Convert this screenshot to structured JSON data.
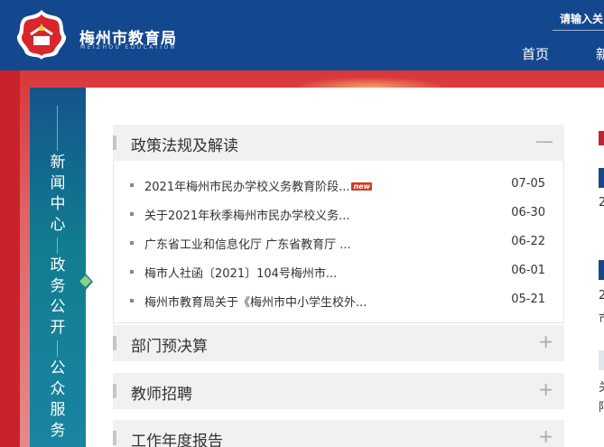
{
  "header": {
    "site_name": "梅州市教育局",
    "site_name_en": "MEIZHOU EDUCATION",
    "search_placeholder": "请输入关",
    "nav": [
      "首页",
      "新"
    ]
  },
  "sidenav": {
    "items": [
      {
        "label": [
          "新",
          "闻",
          "中",
          "心"
        ]
      },
      {
        "label": [
          "政",
          "务",
          "公",
          "开"
        ],
        "active": true
      },
      {
        "label": [
          "公",
          "众",
          "服",
          "务"
        ]
      }
    ]
  },
  "sections": [
    {
      "title": "政策法规及解读",
      "toggle": "—",
      "expanded": true,
      "items": [
        {
          "title": "2021年梅州市民办学校义务教育阶段...",
          "date": "07-05",
          "badge": "new"
        },
        {
          "title": "关于2021年秋季梅州市民办学校义务...",
          "date": "06-30"
        },
        {
          "title": "广东省工业和信息化厅 广东省教育厅 ...",
          "date": "06-22"
        },
        {
          "title": "梅市人社函〔2021〕104号梅州市...",
          "date": "06-01"
        },
        {
          "title": "梅州市教育局关于《梅州市中小学生校外...",
          "date": "05-21"
        }
      ]
    },
    {
      "title": "部门预决算",
      "toggle": "+"
    },
    {
      "title": "教师招聘",
      "toggle": "+"
    },
    {
      "title": "工作年度报告",
      "toggle": "+"
    }
  ],
  "right_fragments": [
    "2",
    "2",
    "市",
    "关",
    "阳"
  ],
  "colors": {
    "header_bg": "#14488e",
    "banner_red": "#d9373a",
    "sidenav_teal": "#127d8f",
    "badge_red": "#d23a23"
  }
}
